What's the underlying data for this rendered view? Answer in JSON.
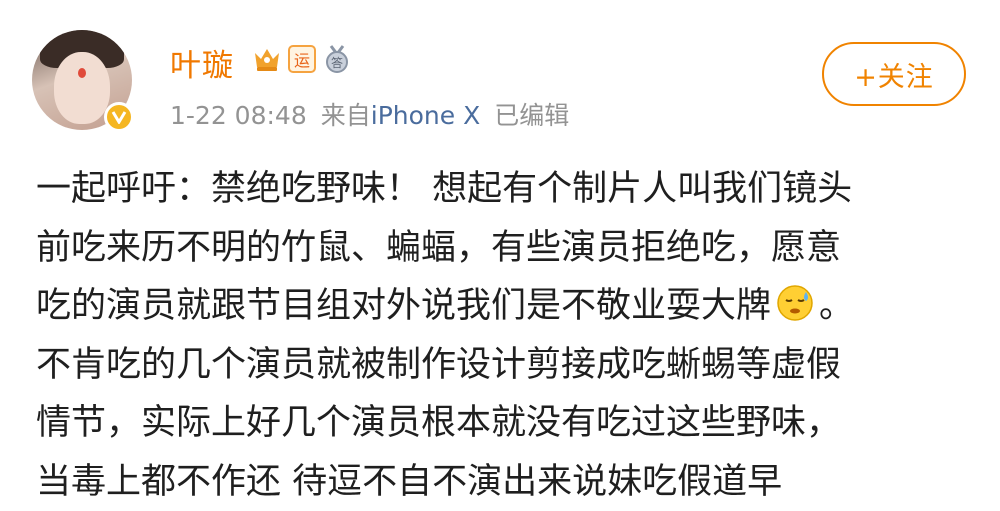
{
  "user": {
    "name": "叶璇",
    "badges": [
      "crown-vip-icon",
      "yun-badge-icon",
      "achievement-medal-icon"
    ],
    "badge_yun_label": "运",
    "badge_medal_label": "答",
    "verified": "verified-v-icon"
  },
  "meta": {
    "time": "1-22 08:48",
    "source_prefix": "来自",
    "source": "iPhone X",
    "edited": "已编辑"
  },
  "follow_button": "+关注",
  "post": {
    "lines": [
      "一起呼吁：禁绝吃野味！   想起有个制片人叫我们镜头",
      "前吃来历不明的竹鼠、蝙蝠，有些演员拒绝吃，愿意",
      "吃的演员就跟节目组对外说我们是不敬业耍大牌",
      "。",
      "不肯吃的几个演员就被制作设计剪接成吃蜥蜴等虚假",
      "情节，实际上好几个演员根本就没有吃过这些野味，",
      "当毒上都不作还   待逗不自不演出来说妹吃假道早"
    ]
  },
  "colors": {
    "name": "#f07800",
    "source": "#4a6c9d",
    "meta": "#939393",
    "follow": "#f08300",
    "text": "#1f1f1f"
  }
}
